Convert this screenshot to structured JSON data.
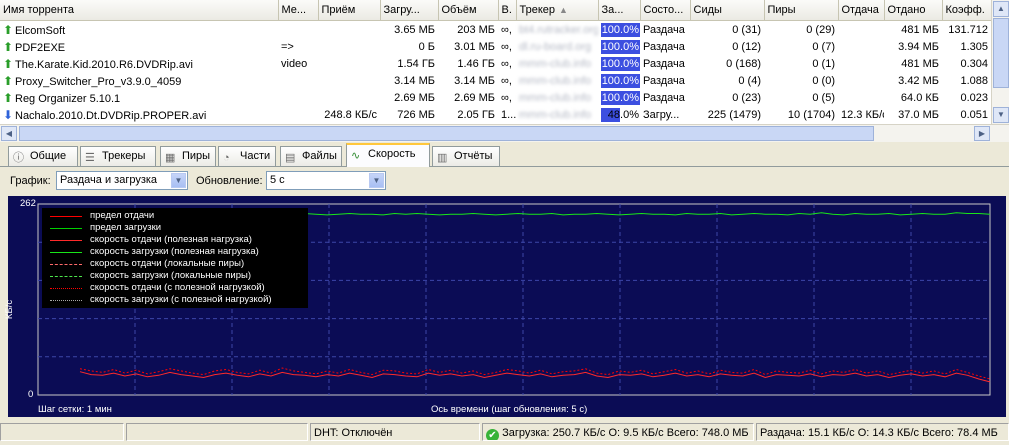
{
  "columns": {
    "name": "Имя торрента",
    "category": "Ме...",
    "received": "Приём",
    "downloaded": "Загру...",
    "size": "Объём",
    "v": "В.",
    "tracker": "Трекер",
    "complete": "За...",
    "state": "Состо...",
    "seeds": "Сиды",
    "peers": "Пиры",
    "upload": "Отдача",
    "uploaded": "Отдано",
    "ratio": "Коэфф."
  },
  "torrents": [
    {
      "name": "ElcomSoft",
      "category": "",
      "received": "",
      "downloaded": "3.65 МБ",
      "size": "203 МБ",
      "v": "∞,",
      "tracker": "bt4.rutracker.org",
      "pct_label": "100.0%",
      "progress": 100,
      "state": "Раздача",
      "seeds": "0 (31)",
      "peers": "0 (29)",
      "upload": "",
      "uploaded": "481 МБ",
      "ratio": "131.712",
      "dir": "up"
    },
    {
      "name": "PDF2EXE",
      "category": "=>",
      "received": "",
      "downloaded": "0 Б",
      "size": "3.01 МБ",
      "v": "∞,",
      "tracker": "dl.ru-board.org",
      "pct_label": "100.0%",
      "progress": 100,
      "state": "Раздача",
      "seeds": "0 (12)",
      "peers": "0 (7)",
      "upload": "",
      "uploaded": "3.94 МБ",
      "ratio": "1.305",
      "dir": "up"
    },
    {
      "name": "The.Karate.Kid.2010.R6.DVDRip.avi",
      "category": "video",
      "received": "",
      "downloaded": "1.54 ГБ",
      "size": "1.46 ГБ",
      "v": "∞,",
      "tracker": "mmm-club.info",
      "pct_label": "100.0%",
      "progress": 100,
      "state": "Раздача",
      "seeds": "0 (168)",
      "peers": "0 (1)",
      "upload": "",
      "uploaded": "481 МБ",
      "ratio": "0.304",
      "dir": "up"
    },
    {
      "name": "Proxy_Switcher_Pro_v3.9.0_4059",
      "category": "",
      "received": "",
      "downloaded": "3.14 МБ",
      "size": "3.14 МБ",
      "v": "∞,",
      "tracker": "mmm-club.info",
      "pct_label": "100.0%",
      "progress": 100,
      "state": "Раздача",
      "seeds": "0 (4)",
      "peers": "0 (0)",
      "upload": "",
      "uploaded": "3.42 МБ",
      "ratio": "1.088",
      "dir": "up"
    },
    {
      "name": "Reg Organizer 5.10.1",
      "category": "",
      "received": "",
      "downloaded": "2.69 МБ",
      "size": "2.69 МБ",
      "v": "∞,",
      "tracker": "mmm-club.info",
      "pct_label": "100.0%",
      "progress": 100,
      "state": "Раздача",
      "seeds": "0 (23)",
      "peers": "0 (5)",
      "upload": "",
      "uploaded": "64.0 КБ",
      "ratio": "0.023",
      "dir": "up"
    },
    {
      "name": "Nachalo.2010.Dt.DVDRip.PROPER.avi",
      "category": "",
      "received": "248.8 КБ/с",
      "downloaded": "726 МБ",
      "size": "2.05 ГБ",
      "v": "1...",
      "tracker": "mmm-club.info",
      "pct_label": "48.0%",
      "progress": 48,
      "state": "Загру...",
      "seeds": "225 (1479)",
      "peers": "10 (1704)",
      "upload": "12.3 КБ/с",
      "uploaded": "37.0 МБ",
      "ratio": "0.051",
      "dir": "down"
    }
  ],
  "tabs": [
    {
      "label": "Общие",
      "active": false,
      "icon": "info-icon"
    },
    {
      "label": "Трекеры",
      "active": false,
      "icon": "trackers-icon"
    },
    {
      "label": "Пиры",
      "active": false,
      "icon": "peers-icon"
    },
    {
      "label": "Части",
      "active": false,
      "icon": "pieces-icon"
    },
    {
      "label": "Файлы",
      "active": false,
      "icon": "files-icon"
    },
    {
      "label": "Скорость",
      "active": true,
      "icon": "speed-icon"
    },
    {
      "label": "Отчёты",
      "active": false,
      "icon": "logger-icon"
    }
  ],
  "controls": {
    "graph_label": "График:",
    "graph_value": "Раздача и загрузка",
    "update_label": "Обновление:",
    "update_value": "5 с"
  },
  "chart_data": {
    "type": "line",
    "ylabel": "КБ/с",
    "ylim": [
      0,
      262
    ],
    "ytick_top": "262",
    "ytick_bottom": "0",
    "grid": true,
    "legend_placement": "top-left",
    "grid_step_label": "Шаг сетки: 1 мин",
    "xlabel": "Ось времени (шаг обновления: 5 с)",
    "series": [
      {
        "name": "предел отдачи",
        "color": "#ff0000",
        "dash": "solid",
        "values": []
      },
      {
        "name": "предел загрузки",
        "color": "#00d000",
        "dash": "solid",
        "values": []
      },
      {
        "name": "скорость отдачи (полезная нагрузка)",
        "color": "#ff2a2a",
        "dash": "solid",
        "values": [
          32,
          28,
          27,
          30,
          26,
          29,
          25,
          27,
          31,
          28,
          26,
          24,
          28,
          30,
          27,
          25,
          29,
          26,
          31,
          28,
          27,
          25,
          28,
          26,
          30,
          27,
          24,
          29,
          28,
          26,
          25,
          30,
          27,
          29,
          26,
          28,
          24,
          27,
          30,
          28,
          26,
          29,
          25,
          27,
          28,
          31,
          26,
          24,
          28,
          27,
          29,
          25,
          27,
          30,
          26,
          28,
          25,
          29,
          27,
          26,
          30,
          24,
          28,
          27,
          26,
          29,
          25,
          28,
          27,
          30,
          26,
          28,
          24,
          27,
          29,
          26,
          28,
          25,
          30,
          27,
          22,
          18
        ]
      },
      {
        "name": "скорость загрузки (полезная нагрузка)",
        "color": "#19e619",
        "dash": "solid",
        "values": [
          248,
          248,
          249,
          247,
          248,
          249,
          248,
          247,
          248,
          249,
          248,
          248,
          247,
          249,
          248,
          248,
          249,
          247,
          248,
          248,
          249,
          248,
          247,
          248,
          249,
          248,
          248,
          247,
          249,
          248,
          249,
          248,
          247,
          248,
          248,
          249,
          248,
          247,
          248,
          249,
          248,
          248,
          249,
          247,
          248,
          248,
          249,
          248,
          247,
          248,
          249,
          248,
          248,
          247,
          249,
          248,
          248,
          249,
          247,
          248,
          249,
          248,
          248,
          247,
          249,
          248,
          250,
          248,
          247,
          249,
          248,
          248,
          249,
          247,
          248,
          249,
          248,
          248,
          250,
          249,
          249,
          248
        ]
      },
      {
        "name": "скорость отдачи (локальные пиры)",
        "color": "#ff6a6a",
        "dash": "dash-dot",
        "values": []
      },
      {
        "name": "скорость загрузки (локальные пиры)",
        "color": "#4ce64c",
        "dash": "dash-dot",
        "values": []
      },
      {
        "name": "скорость отдачи (с полезной нагрузкой)",
        "color": "#ff0000",
        "dash": "dotted",
        "values": [
          36,
          33,
          31,
          35,
          30,
          34,
          29,
          32,
          36,
          33,
          30,
          28,
          33,
          35,
          31,
          29,
          34,
          30,
          37,
          33,
          31,
          29,
          33,
          30,
          35,
          31,
          28,
          34,
          33,
          30,
          29,
          35,
          31,
          34,
          30,
          33,
          28,
          31,
          35,
          33,
          30,
          34,
          29,
          32,
          33,
          36,
          30,
          28,
          33,
          31,
          34,
          29,
          32,
          35,
          30,
          33,
          29,
          34,
          31,
          30,
          35,
          28,
          33,
          31,
          30,
          34,
          29,
          33,
          31,
          35,
          30,
          33,
          28,
          31,
          34,
          30,
          33,
          29,
          35,
          31,
          26,
          22
        ]
      },
      {
        "name": "скорость загрузки (с полезной нагрузкой)",
        "color": "#aaaaaa",
        "dash": "dotted",
        "values": []
      }
    ]
  },
  "status": {
    "dht": "DHT: Отключён",
    "download": "Загрузка: 250.7 КБ/с О: 9.5 КБ/с Всего: 748.0 МБ",
    "upload": "Раздача: 15.1 КБ/с О: 14.3 КБ/с Всего: 78.4 МБ"
  }
}
